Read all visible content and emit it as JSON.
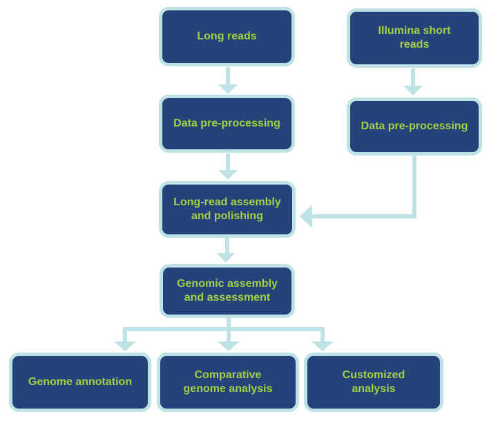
{
  "diagram": {
    "type": "flowchart",
    "colors": {
      "node_fill": "#26427a",
      "node_border": "#bfe2e6",
      "node_text": "#a3d146",
      "arrow": "#bfe2e6"
    },
    "nodes": {
      "long_reads": "Long reads",
      "illumina_short_reads": "Illumina short\nreads",
      "long_preprocessing": "Data pre-processing",
      "short_preprocessing": "Data pre-processing",
      "long_read_assembly": "Long-read assembly\nand polishing",
      "genomic_assembly": "Genomic assembly\nand assessment",
      "genome_annotation": "Genome annotation",
      "comparative_analysis": "Comparative\ngenome analysis",
      "customized_analysis": "Customized\nanalysis"
    },
    "edges": [
      {
        "from": "long_reads",
        "to": "long_preprocessing"
      },
      {
        "from": "illumina_short_reads",
        "to": "short_preprocessing"
      },
      {
        "from": "long_preprocessing",
        "to": "long_read_assembly"
      },
      {
        "from": "short_preprocessing",
        "to": "long_read_assembly"
      },
      {
        "from": "long_read_assembly",
        "to": "genomic_assembly"
      },
      {
        "from": "genomic_assembly",
        "to": "genome_annotation"
      },
      {
        "from": "genomic_assembly",
        "to": "comparative_analysis"
      },
      {
        "from": "genomic_assembly",
        "to": "customized_analysis"
      }
    ]
  }
}
